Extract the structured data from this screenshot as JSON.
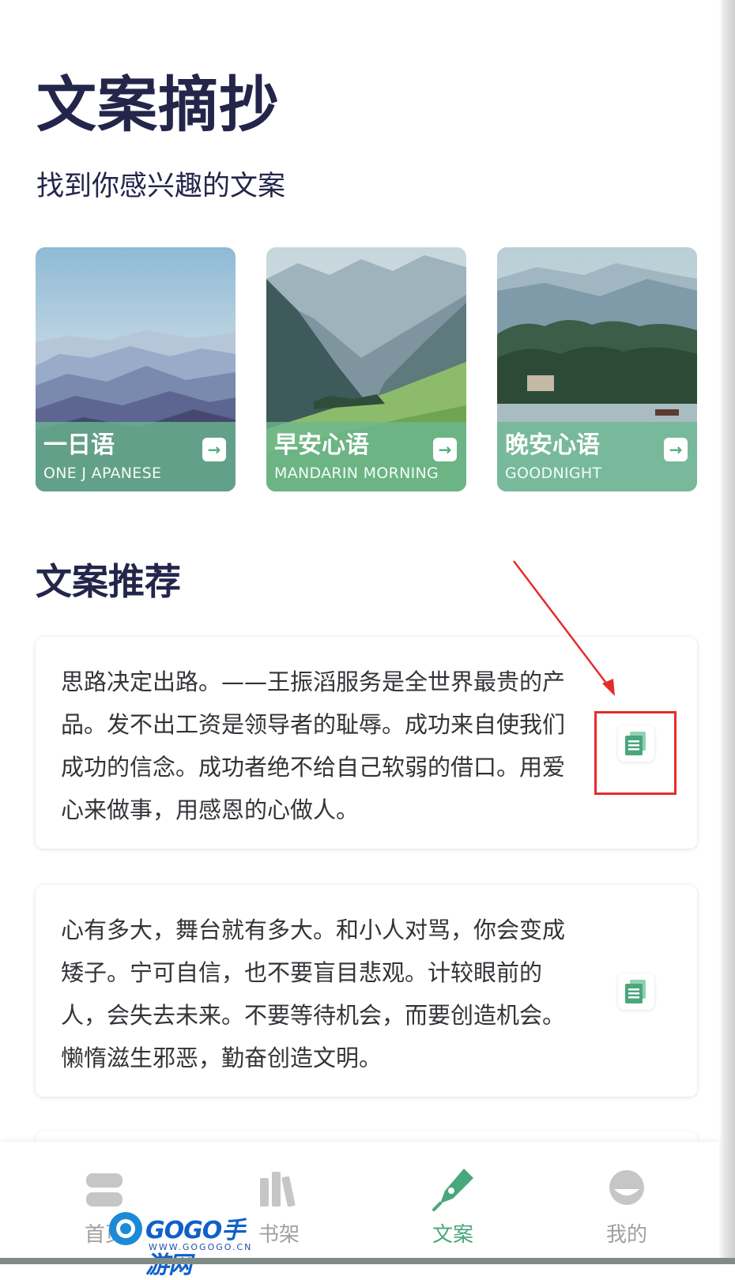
{
  "header": {
    "title": "文案摘抄",
    "subtitle": "找到你感兴趣的文案"
  },
  "categories": [
    {
      "name": "一日语",
      "en": "ONE J APANESE",
      "icon": "arrow-right-icon"
    },
    {
      "name": "早安心语",
      "en": "MANDARIN MORNING",
      "icon": "arrow-right-icon"
    },
    {
      "name": "晚安心语",
      "en": "GOODNIGHT",
      "icon": "arrow-right-icon"
    }
  ],
  "recommend": {
    "title": "文案推荐",
    "quotes": [
      {
        "text": "思路决定出路。——王振滔服务是全世界最贵的产品。发不出工资是领导者的耻辱。成功来自使我们成功的信念。成功者绝不给自己软弱的借口。用爱心来做事，用感恩的心做人。",
        "icon": "copy-icon"
      },
      {
        "text": "心有多大，舞台就有多大。和小人对骂，你会变成矮子。宁可自信，也不要盲目悲观。计较眼前的人，会失去未来。不要等待机会，而要创造机会。懒惰滋生邪恶，勤奋创造文明。",
        "icon": "copy-icon"
      }
    ]
  },
  "tabbar": {
    "items": [
      {
        "label": "首页",
        "icon": "home-icon"
      },
      {
        "label": "书架",
        "icon": "bookshelf-icon"
      },
      {
        "label": "文案",
        "icon": "pen-icon",
        "active": true
      },
      {
        "label": "我的",
        "icon": "profile-icon"
      }
    ]
  },
  "watermark": {
    "text": "GOGO手游网",
    "url": "WWW.GOGOGO.CN"
  },
  "colors": {
    "accent": "#4aa67b",
    "title": "#23264a",
    "highlight": "#e32d2d"
  }
}
